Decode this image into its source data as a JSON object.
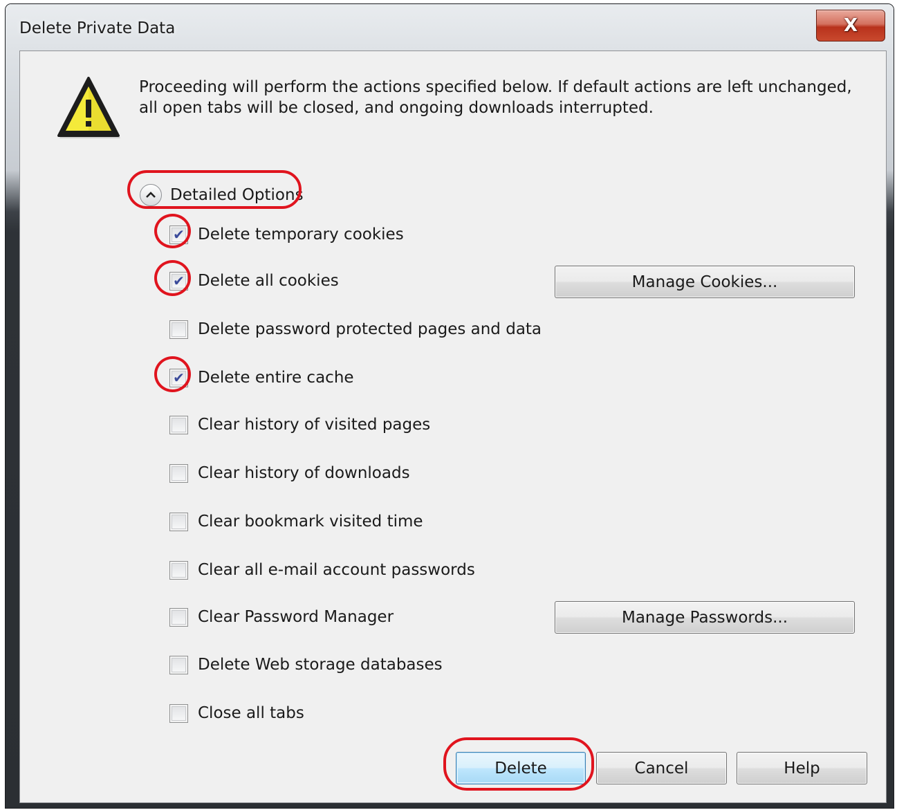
{
  "window": {
    "title": "Delete Private Data",
    "close_label": "X"
  },
  "message": "Proceeding will perform the actions specified below. If default actions are left unchanged, all open tabs will be closed, and ongoing downloads interrupted.",
  "toggle": {
    "label": "Detailed Options",
    "icon": "chevron-up-icon"
  },
  "options": [
    {
      "label": "Delete temporary cookies",
      "checked": true
    },
    {
      "label": "Delete all cookies",
      "checked": true
    },
    {
      "label": "Delete password protected pages and data",
      "checked": false
    },
    {
      "label": "Delete entire cache",
      "checked": true
    },
    {
      "label": "Clear history of visited pages",
      "checked": false
    },
    {
      "label": "Clear history of downloads",
      "checked": false
    },
    {
      "label": "Clear bookmark visited time",
      "checked": false
    },
    {
      "label": "Clear all e-mail account passwords",
      "checked": false
    },
    {
      "label": "Clear Password Manager",
      "checked": false
    },
    {
      "label": "Delete Web storage databases",
      "checked": false
    },
    {
      "label": "Close all tabs",
      "checked": false
    }
  ],
  "buttons": {
    "manage_cookies": "Manage Cookies...",
    "manage_passwords": "Manage Passwords...",
    "delete": "Delete",
    "cancel": "Cancel",
    "help": "Help"
  },
  "colors": {
    "annotation": "#e0141e",
    "warning_fill": "#f4ea3a",
    "check_mark": "#3a4a9a"
  }
}
